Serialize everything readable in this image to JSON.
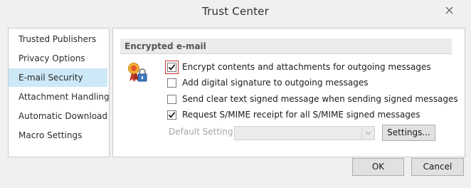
{
  "window": {
    "title": "Trust Center"
  },
  "sidebar": {
    "items": [
      {
        "label": "Trusted Publishers",
        "selected": false
      },
      {
        "label": "Privacy Options",
        "selected": false
      },
      {
        "label": "E-mail Security",
        "selected": true
      },
      {
        "label": "Attachment Handling",
        "selected": false
      },
      {
        "label": "Automatic Download",
        "selected": false
      },
      {
        "label": "Macro Settings",
        "selected": false
      }
    ]
  },
  "main": {
    "section_title": "Encrypted e-mail",
    "section_icon": "certificate-lock-icon",
    "options": [
      {
        "label": "Encrypt contents and attachments for outgoing messages",
        "checked": true
      },
      {
        "label": "Add digital signature to outgoing messages",
        "checked": false
      },
      {
        "label": "Send clear text signed message when sending signed messages",
        "checked": false
      },
      {
        "label": "Request S/MIME receipt for all S/MIME signed messages",
        "checked": true
      }
    ],
    "default_setting": {
      "label": "Default Setting:",
      "value": ""
    },
    "settings_button": "Settings..."
  },
  "footer": {
    "ok_label": "OK",
    "cancel_label": "Cancel"
  },
  "colors": {
    "selected_item": "#cde8f7",
    "focus_border": "#c9343a"
  }
}
